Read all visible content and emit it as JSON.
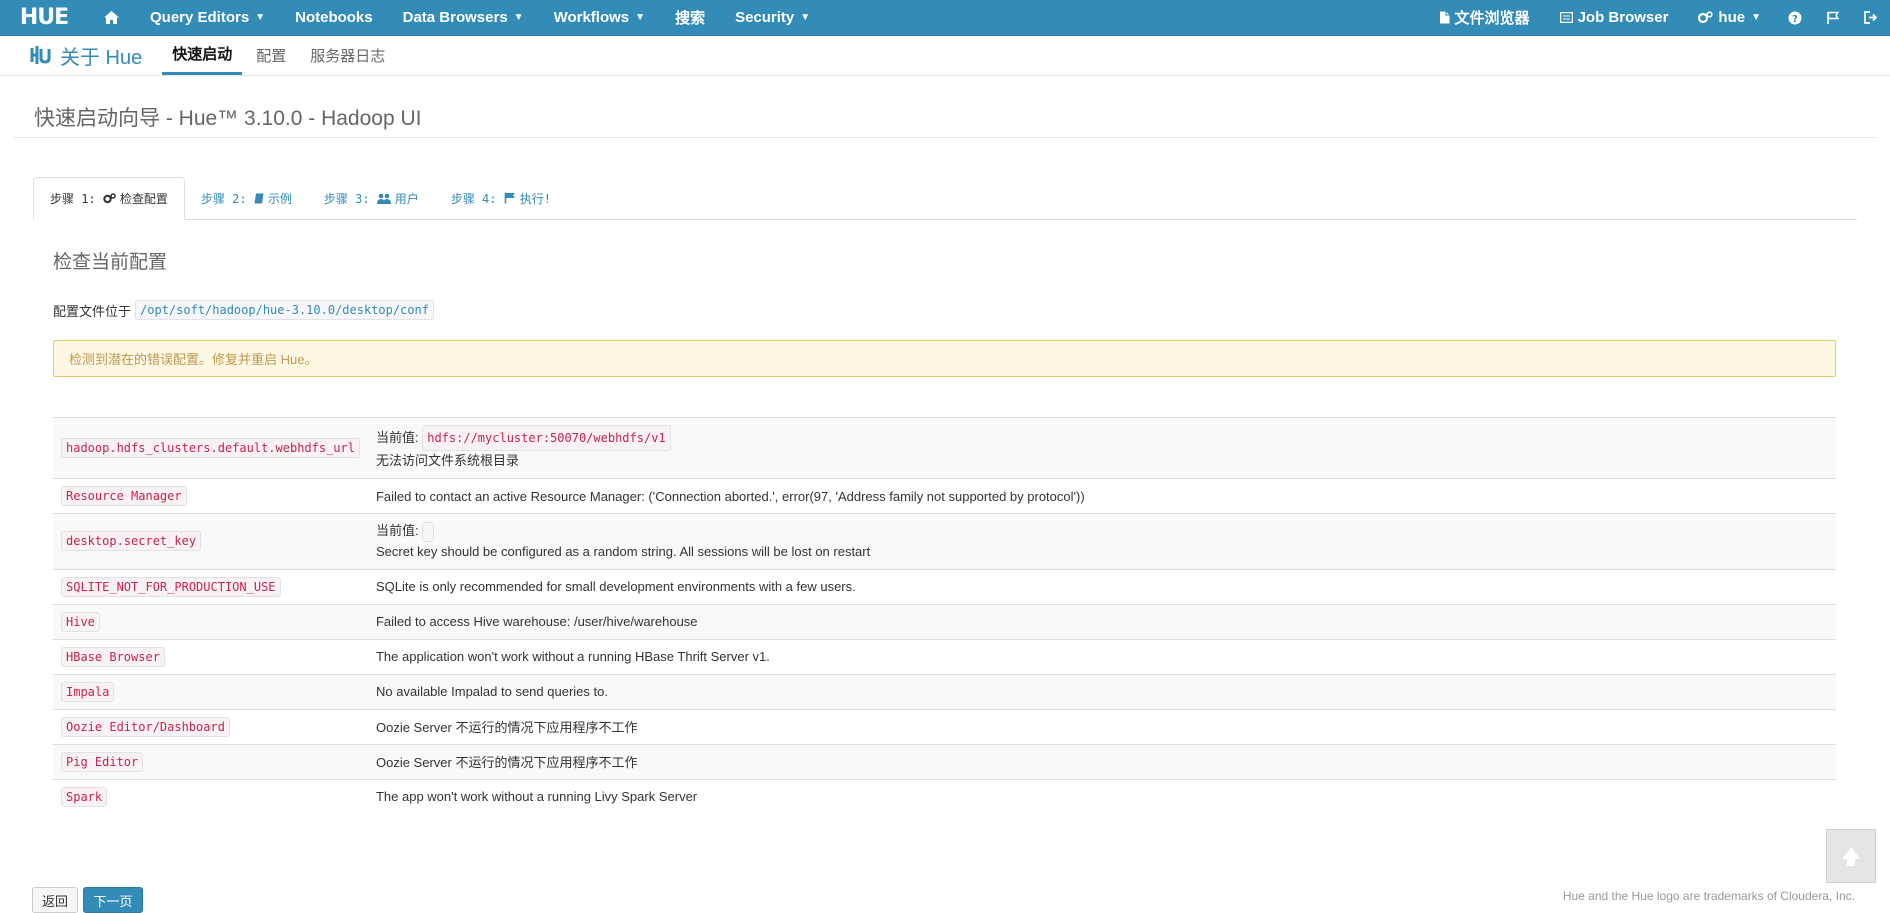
{
  "topbar": {
    "brand": "HUE",
    "nav": [
      {
        "label": "Query Editors",
        "dropdown": true
      },
      {
        "label": "Notebooks",
        "dropdown": false
      },
      {
        "label": "Data Browsers",
        "dropdown": true
      },
      {
        "label": "Workflows",
        "dropdown": true
      },
      {
        "label": "搜索",
        "dropdown": false
      },
      {
        "label": "Security",
        "dropdown": true
      }
    ],
    "right": {
      "file_browser": "文件浏览器",
      "job_browser": "Job Browser",
      "user": "hue"
    },
    "colors": {
      "bar": "#338bb8"
    }
  },
  "subnav": {
    "app_title": "关于 Hue",
    "tabs": [
      {
        "label": "快速启动",
        "active": true
      },
      {
        "label": "配置",
        "active": false
      },
      {
        "label": "服务器日志",
        "active": false
      }
    ]
  },
  "page": {
    "title": "快速启动向导 - Hue™ 3.10.0 - Hadoop UI"
  },
  "steps": [
    {
      "prefix": "步骤 1:",
      "label": "检查配置",
      "icon": "cogs-icon",
      "active": true
    },
    {
      "prefix": "步骤 2:",
      "label": "示例",
      "icon": "book-icon",
      "active": false
    },
    {
      "prefix": "步骤 3:",
      "label": "用户",
      "icon": "users-icon",
      "active": false
    },
    {
      "prefix": "步骤 4:",
      "label": "执行!",
      "icon": "flag-icon",
      "active": false
    }
  ],
  "section": {
    "title": "检查当前配置",
    "conf_label": "配置文件位于",
    "conf_path": "/opt/soft/hadoop/hue-3.10.0/desktop/conf",
    "alert": "检测到潜在的错误配置。修复并重启 Hue。"
  },
  "config_rows": [
    {
      "key": "hadoop.hdfs_clusters.default.webhdfs_url",
      "current_label": "当前值:",
      "current_value": "hdfs://mycluster:50070/webhdfs/v1",
      "message": "无法访问文件系统根目录"
    },
    {
      "key": "Resource Manager",
      "message": "Failed to contact an active Resource Manager: ('Connection aborted.', error(97, 'Address family not supported by protocol'))"
    },
    {
      "key": "desktop.secret_key",
      "current_label": "当前值:",
      "current_value": "",
      "message": "Secret key should be configured as a random string. All sessions will be lost on restart"
    },
    {
      "key": "SQLITE_NOT_FOR_PRODUCTION_USE",
      "message": "SQLite is only recommended for small development environments with a few users."
    },
    {
      "key": "Hive",
      "message": "Failed to access Hive warehouse: /user/hive/warehouse"
    },
    {
      "key": "HBase Browser",
      "message": "The application won't work without a running HBase Thrift Server v1."
    },
    {
      "key": "Impala",
      "message": "No available Impalad to send queries to."
    },
    {
      "key": "Oozie Editor/Dashboard",
      "message": "Oozie Server 不运行的情况下应用程序不工作"
    },
    {
      "key": "Pig Editor",
      "message": "Oozie Server 不运行的情况下应用程序不工作"
    },
    {
      "key": "Spark",
      "message": "The app won't work without a running Livy Spark Server"
    }
  ],
  "bottom": {
    "back": "返回",
    "next": "下一页",
    "footer": "Hue and the Hue logo are trademarks of Cloudera, Inc."
  }
}
